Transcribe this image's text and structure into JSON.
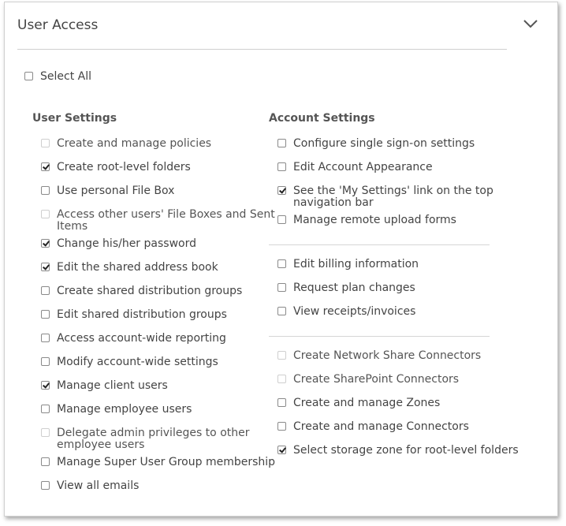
{
  "panel": {
    "title": "User Access"
  },
  "select_all": {
    "label": "Select All",
    "checked": false
  },
  "user_settings": {
    "heading": "User Settings",
    "items": [
      {
        "label": "Create and manage policies",
        "checked": false,
        "disabled": true
      },
      {
        "label": "Create root-level folders",
        "checked": true,
        "disabled": false
      },
      {
        "label": "Use personal File Box",
        "checked": false,
        "disabled": false
      },
      {
        "label": "Access other users' File Boxes and Sent Items",
        "line1": "Access other users' File Boxes and Sent",
        "line2": "Items",
        "checked": false,
        "disabled": true
      },
      {
        "label": "Change his/her password",
        "checked": true,
        "disabled": false
      },
      {
        "label": "Edit the shared address book",
        "checked": true,
        "disabled": false
      },
      {
        "label": "Create shared distribution groups",
        "checked": false,
        "disabled": false
      },
      {
        "label": "Edit shared distribution groups",
        "checked": false,
        "disabled": false
      },
      {
        "label": "Access account-wide reporting",
        "checked": false,
        "disabled": false
      },
      {
        "label": "Modify account-wide settings",
        "checked": false,
        "disabled": false
      },
      {
        "label": "Manage client users",
        "checked": true,
        "disabled": false
      },
      {
        "label": "Manage employee users",
        "checked": false,
        "disabled": false
      },
      {
        "label": "Delegate admin privileges to other employee users",
        "line1": "Delegate admin privileges to other",
        "line2": "employee users",
        "checked": false,
        "disabled": true
      },
      {
        "label": "Manage Super User Group membership",
        "checked": false,
        "disabled": false
      },
      {
        "label": "View all emails",
        "checked": false,
        "disabled": false
      }
    ]
  },
  "account_settings": {
    "heading": "Account Settings",
    "items": [
      {
        "label": "Configure single sign-on settings",
        "checked": false,
        "disabled": false
      },
      {
        "label": "Edit Account Appearance",
        "checked": false,
        "disabled": false
      },
      {
        "label": "See the 'My Settings' link on the top navigation bar",
        "line1": "See the 'My Settings' link on the top",
        "line2": "navigation bar",
        "checked": true,
        "disabled": false
      },
      {
        "label": "Manage remote upload forms",
        "checked": false,
        "disabled": false
      },
      {
        "label": "Edit billing information",
        "checked": false,
        "disabled": false
      },
      {
        "label": "Request plan changes",
        "checked": false,
        "disabled": false
      },
      {
        "label": "View receipts/invoices",
        "checked": false,
        "disabled": false
      },
      {
        "label": "Create Network Share Connectors",
        "checked": false,
        "disabled": true
      },
      {
        "label": "Create SharePoint Connectors",
        "checked": false,
        "disabled": true
      },
      {
        "label": "Create and manage Zones",
        "checked": false,
        "disabled": false
      },
      {
        "label": "Create and manage Connectors",
        "checked": false,
        "disabled": false
      },
      {
        "label": "Select storage zone for root-level folders",
        "checked": true,
        "disabled": false
      }
    ]
  }
}
